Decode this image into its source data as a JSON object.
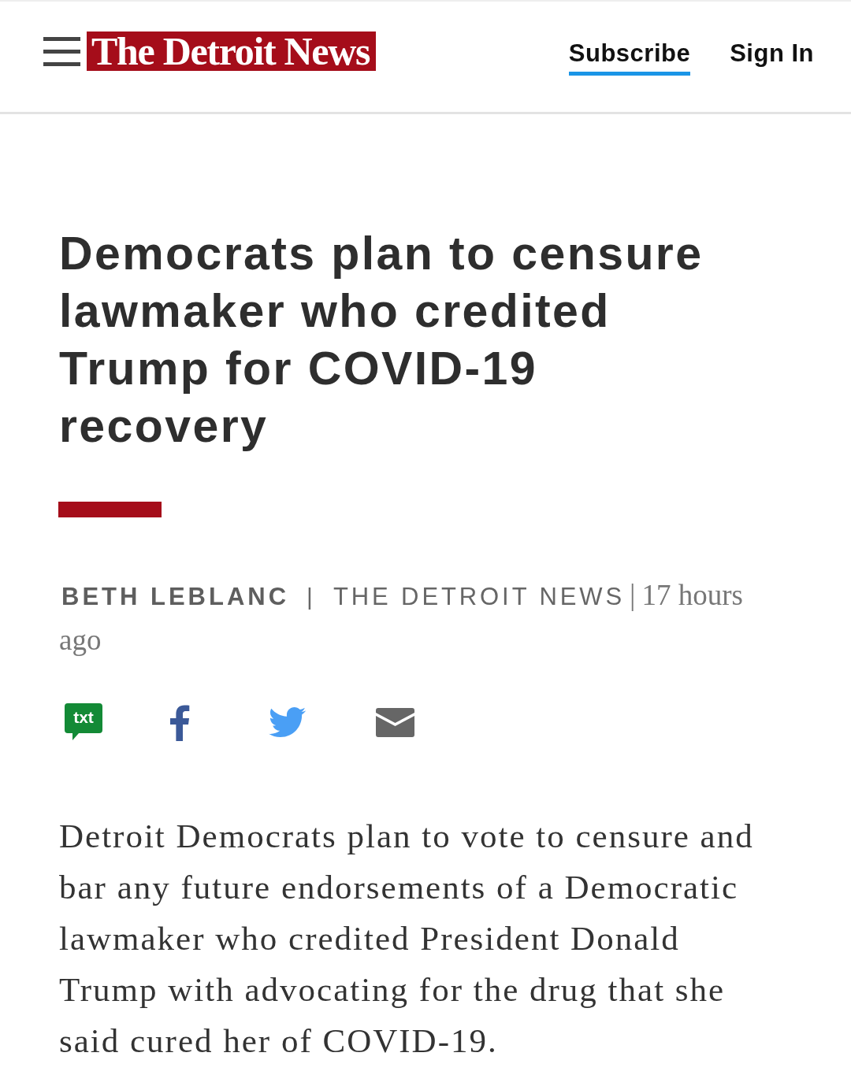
{
  "header": {
    "logo": "The Detroit News",
    "links": [
      {
        "label": "Subscribe",
        "underlined": true
      },
      {
        "label": "Sign In",
        "underlined": false
      }
    ]
  },
  "article": {
    "headline": "Democrats plan to censure lawmaker who credited Trump for COVID-19 recovery",
    "byline": [
      {
        "kind": "author",
        "text": "BETH LEBLANC"
      },
      {
        "kind": "separator",
        "text": "|"
      },
      {
        "kind": "publisher",
        "text": "THE DETROIT NEWS"
      },
      {
        "kind": "separator",
        "text": "|"
      },
      {
        "kind": "time",
        "text": "17 hours ago"
      }
    ],
    "share_buttons": [
      {
        "kind": "sms",
        "label": "txt"
      },
      {
        "kind": "facebook"
      },
      {
        "kind": "twitter"
      },
      {
        "kind": "email"
      }
    ],
    "paragraphs": [
      "Detroit Democrats plan to vote to censure and bar any future endorsements of a Democratic lawmaker who credited President Donald Trump with advocating for the drug that she said cured her of COVID-19."
    ]
  }
}
